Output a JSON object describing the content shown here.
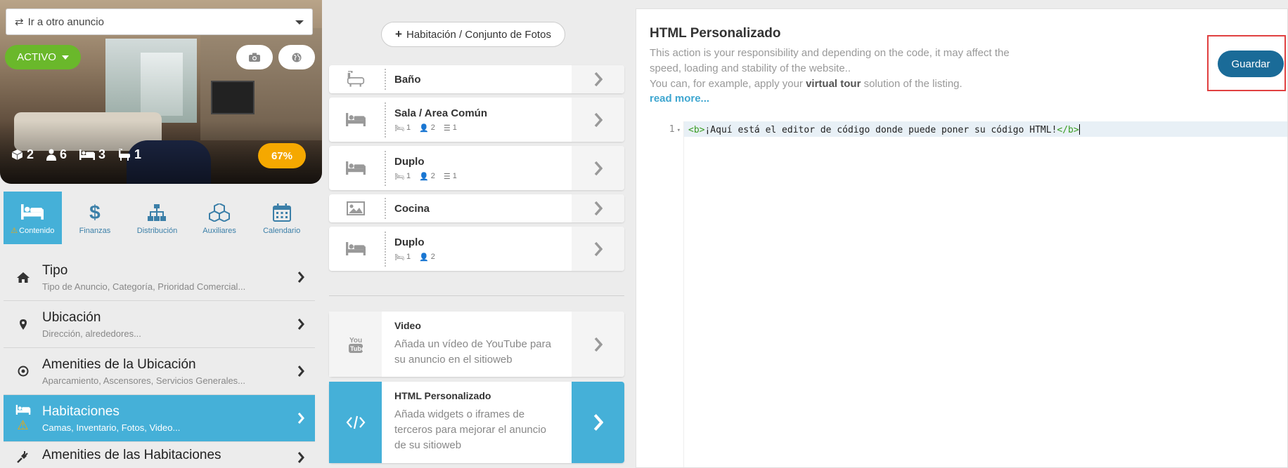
{
  "colors": {
    "accent": "#45b0d8",
    "active_green": "#6ab82b",
    "progress_orange": "#f5a800",
    "save_blue": "#1a6b98",
    "highlight_red": "#e04040"
  },
  "left": {
    "goto": {
      "label": "Ir a otro anuncio",
      "icon": "swap-arrows-icon"
    },
    "status": {
      "label": "ACTIVO"
    },
    "stats": [
      {
        "icon": "cube-icon",
        "value": "2"
      },
      {
        "icon": "person-icon",
        "value": "6"
      },
      {
        "icon": "bed-icon",
        "value": "3"
      },
      {
        "icon": "bathtub-icon",
        "value": "1"
      }
    ],
    "progress": {
      "label": "67%",
      "value": 0.67
    },
    "tabs": [
      {
        "label": "Contenido",
        "icon": "bed-icon",
        "active": true,
        "warning": true
      },
      {
        "label": "Finanzas",
        "icon": "dollar-icon"
      },
      {
        "label": "Distribución",
        "icon": "sitemap-icon"
      },
      {
        "label": "Auxiliares",
        "icon": "cubes-icon"
      },
      {
        "label": "Calendario",
        "icon": "calendar-icon"
      }
    ],
    "menu": [
      {
        "title": "Tipo",
        "subtitle": "Tipo de Anuncio, Categoría, Prioridad Comercial...",
        "icon": "home-icon"
      },
      {
        "title": "Ubicación",
        "subtitle": "Dirección, alrededores...",
        "icon": "map-pin-icon"
      },
      {
        "title": "Amenities de la Ubicación",
        "subtitle": "Aparcamiento, Ascensores, Servicios Generales...",
        "icon": "target-icon"
      },
      {
        "title": "Habitaciones",
        "subtitle": "Camas, Inventario, Fotos, Video...",
        "icon": "bed-icon",
        "active": true
      },
      {
        "title": "Amenities de las Habitaciones",
        "subtitle": "",
        "icon": "plug-icon"
      }
    ]
  },
  "middle": {
    "add_button": "Habitación / Conjunto de Fotos",
    "rooms": [
      {
        "name": "Baño",
        "icon": "bathtub-icon",
        "meta": []
      },
      {
        "name": "Sala / Area Común",
        "icon": "bed-icon",
        "meta": [
          "1",
          "2",
          "1"
        ]
      },
      {
        "name": "Duplo",
        "icon": "bed-icon",
        "meta": [
          "1",
          "2",
          "1"
        ]
      },
      {
        "name": "Cocina",
        "icon": "image-icon",
        "meta": []
      },
      {
        "name": "Duplo",
        "icon": "bed-icon",
        "meta": [
          "1",
          "2"
        ]
      }
    ],
    "video": {
      "title": "Video",
      "description": "Añada un vídeo de YouTube para su anuncio en el sitioweb",
      "icon": "youtube-icon"
    },
    "html": {
      "title": "HTML Personalizado",
      "description": "Añada widgets o iframes de terceros para mejorar el anuncio de su sitioweb",
      "icon": "code-icon"
    }
  },
  "right": {
    "title": "HTML Personalizado",
    "desc_line1": "This action is your responsibility and depending on the code, it may affect the speed, loading and stability of the website..",
    "desc_line2_pre": "You can, for example, apply your ",
    "desc_line2_bold": "virtual tour",
    "desc_line2_post": " solution of the listing.",
    "read_more": "read more...",
    "save_label": "Guardar",
    "editor": {
      "line_number": "1",
      "tag_open": "<b>",
      "content": "¡Aquí está el editor de código donde puede poner su código HTML!",
      "tag_close": "</b>"
    }
  }
}
